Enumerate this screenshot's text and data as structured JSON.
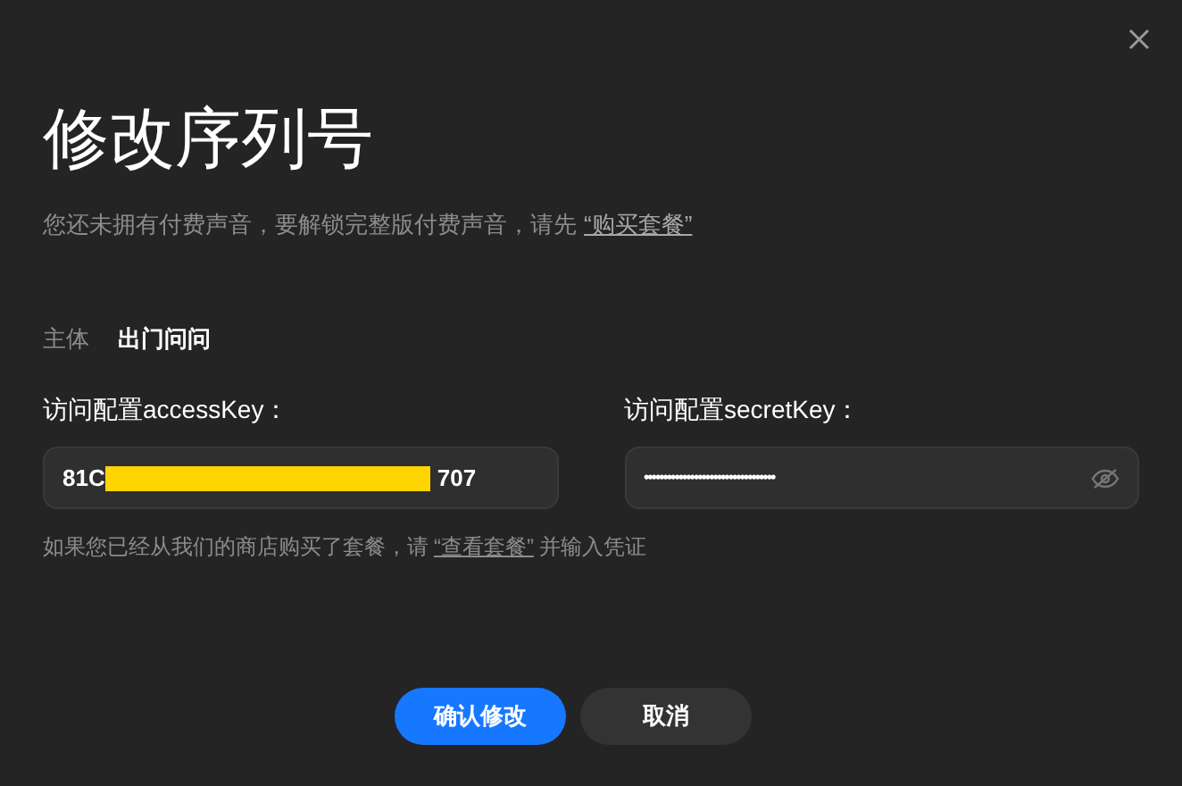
{
  "dialog": {
    "title": "修改序列号",
    "notice": {
      "text": "您还未拥有付费声音，要解锁完整版付费声音，请先",
      "link": "“购买套餐”"
    },
    "subject": {
      "label": "主体",
      "value": "出门问问"
    },
    "fields": [
      {
        "kind": "text",
        "label": "访问配置accessKey：",
        "value_start": "81C",
        "value_end": "707",
        "redacted": true
      },
      {
        "kind": "password",
        "label": "访问配置secretKey：",
        "value": "••••••••••••••••••••••••••••••••••",
        "revealed": false
      }
    ],
    "hint": {
      "text_before": "如果您已经从我们的商店购买了套餐，请",
      "link": "“查看套餐”",
      "text_after": "并输入凭证"
    },
    "buttons": [
      {
        "label": "确认修改",
        "kind": "primary"
      },
      {
        "label": "取消",
        "kind": "secondary"
      }
    ]
  }
}
